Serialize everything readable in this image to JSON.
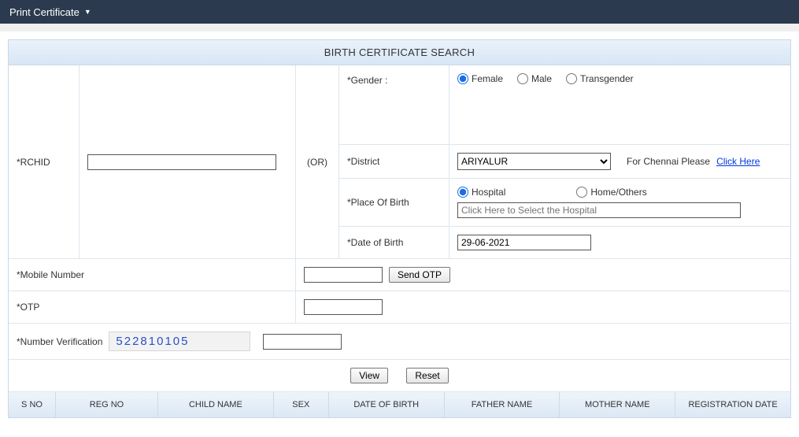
{
  "navbar": {
    "print_cert": "Print Certificate"
  },
  "panel": {
    "title": "BIRTH CERTIFICATE SEARCH"
  },
  "labels": {
    "rchid": "*RCHID",
    "or": "(OR)",
    "gender": "*Gender :",
    "district": "*District",
    "place_of_birth": "*Place Of Birth",
    "date_of_birth": "*Date of Birth",
    "mobile": "*Mobile Number",
    "otp": "*OTP",
    "number_verification": "*Number Verification",
    "chennai_note": "For Chennai Please",
    "click_here": "Click Here"
  },
  "gender_options": {
    "female": "Female",
    "male": "Male",
    "trans": "Transgender"
  },
  "district": {
    "selected": "ARIYALUR"
  },
  "place_options": {
    "hospital": "Hospital",
    "home": "Home/Others"
  },
  "hospital_placeholder": "Click Here to Select the Hospital",
  "dob_value": "29-06-2021",
  "buttons": {
    "send_otp": "Send OTP",
    "view": "View",
    "reset": "Reset"
  },
  "nv_code": "522810105",
  "table_headers": {
    "sno": "S NO",
    "regno": "REG NO",
    "child": "CHILD NAME",
    "sex": "SEX",
    "dob": "DATE OF BIRTH",
    "father": "FATHER NAME",
    "mother": "MOTHER NAME",
    "regdate": "REGISTRATION DATE"
  }
}
